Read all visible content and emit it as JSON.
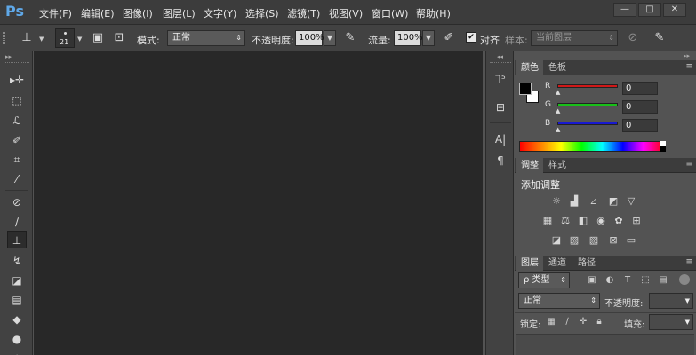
{
  "app": {
    "logo": "Ps"
  },
  "menu": [
    "文件(F)",
    "编辑(E)",
    "图像(I)",
    "图层(L)",
    "文字(Y)",
    "选择(S)",
    "滤镜(T)",
    "视图(V)",
    "窗口(W)",
    "帮助(H)"
  ],
  "window_buttons": {
    "minimize": "—",
    "maximize": "□",
    "close": "✕"
  },
  "options": {
    "brush_size": "21",
    "mode_label": "模式:",
    "mode_value": "正常",
    "opacity_label": "不透明度:",
    "opacity_value": "100%",
    "flow_label": "流量:",
    "flow_value": "100%",
    "align_label": "对齐",
    "align_checked": "✔",
    "sample_label": "样本:",
    "sample_value": "当前图层"
  },
  "color_panel": {
    "tabs": [
      "颜色",
      "色板"
    ],
    "r_label": "R",
    "g_label": "G",
    "b_label": "B",
    "r_value": "0",
    "g_value": "0",
    "b_value": "0",
    "foreground": "#000000",
    "background": "#ffffff"
  },
  "adjust_panel": {
    "tabs": [
      "调整",
      "样式"
    ],
    "title": "添加调整"
  },
  "layers_panel": {
    "tabs": [
      "图层",
      "通道",
      "路径"
    ],
    "filter_label": "ρ 类型",
    "blend_value": "正常",
    "opacity_label": "不透明度:",
    "lock_label": "锁定:",
    "fill_label": "填充:"
  },
  "dock": {
    "text_icon": "A|",
    "para_icon": "¶"
  },
  "colors": {
    "accent": "#5fa8e8",
    "red_slider": "#d01818",
    "green_slider": "#18c018",
    "blue_slider": "#1818d0"
  }
}
